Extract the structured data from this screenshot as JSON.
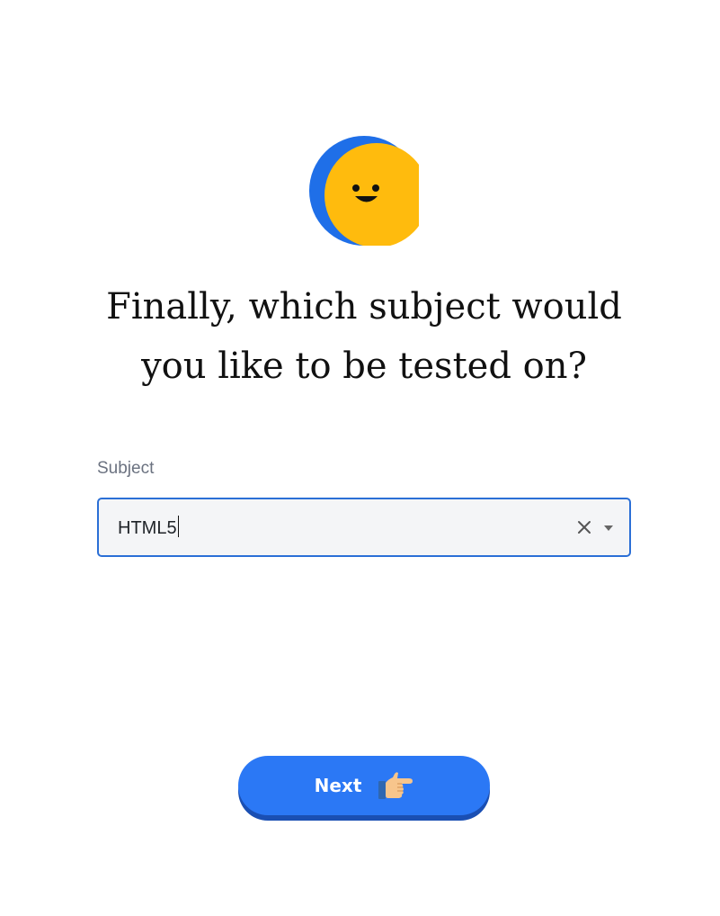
{
  "icons": {
    "mascot": "smiling-face-mascot-icon",
    "clear": "close-icon",
    "dropdown": "chevron-down-icon",
    "next": "pointing-hand-icon"
  },
  "colors": {
    "accent": "#2b78f5",
    "accent_shadow": "#1a4fb3",
    "field_border": "#2b6fd6",
    "field_bg": "#f4f5f7",
    "mascot_blue": "#1f6fe8",
    "mascot_yellow": "#ffbb0d"
  },
  "heading": {
    "line1": "Finally, which subject would",
    "line2": "you like to be tested on?"
  },
  "subject_field": {
    "label": "Subject",
    "value": "HTML5"
  },
  "next_button": {
    "label": "Next"
  }
}
